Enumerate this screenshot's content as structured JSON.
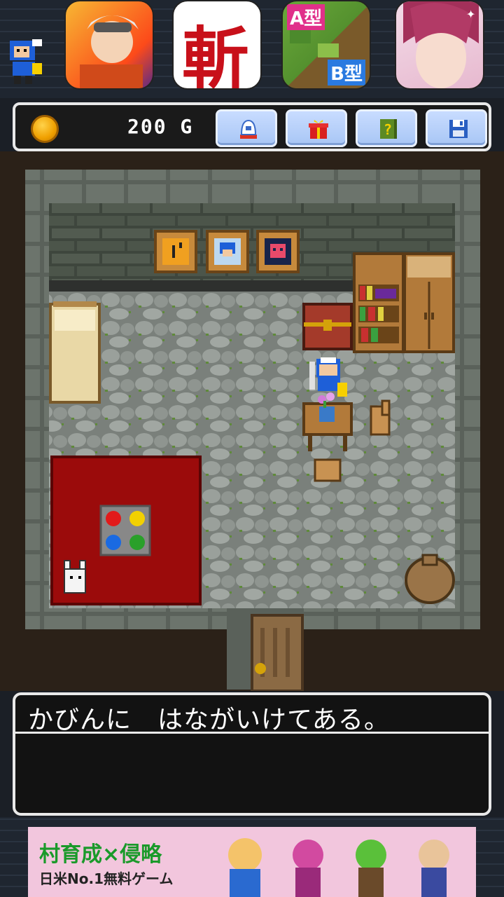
{
  "ads": {
    "icons": [
      {
        "name": "anime-warrior-app",
        "caption": ""
      },
      {
        "name": "zan-app",
        "caption": "斬"
      },
      {
        "name": "farm-ab-app",
        "caption_a": "A型",
        "caption_b": "B型"
      },
      {
        "name": "otome-app",
        "caption": ""
      }
    ]
  },
  "status": {
    "gold_text": "200 G",
    "buttons": [
      "helmet-icon",
      "gift-icon",
      "hint-book-icon",
      "save-icon"
    ]
  },
  "dialog": {
    "message": "かびんに　はながいけてある。"
  },
  "banner": {
    "title": "村育成×侵略",
    "subtitle": "日米No.1無料ゲーム"
  },
  "colors": {
    "floor": "#8f9590",
    "wall": "#4a5248",
    "carpet": "#9b0b0b",
    "ui_border": "#e9e9e9",
    "button_bg": "#b8d2fb"
  }
}
